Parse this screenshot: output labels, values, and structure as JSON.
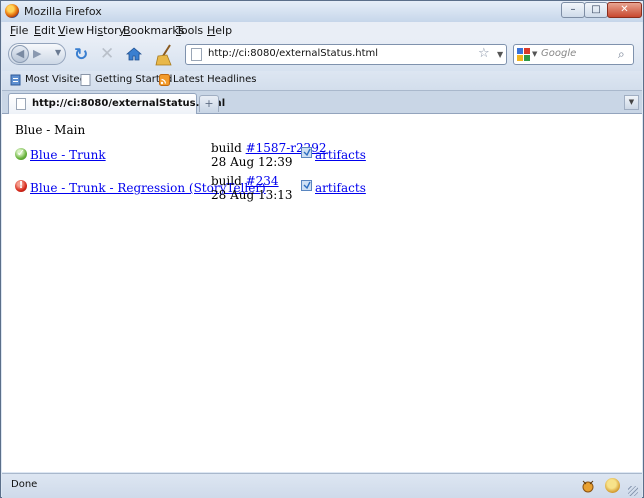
{
  "window": {
    "title": "Mozilla Firefox",
    "minimize": "–",
    "maximize": "□",
    "close": "✕"
  },
  "menubar": [
    {
      "accel": "F",
      "rest": "ile"
    },
    {
      "accel": "E",
      "rest": "dit"
    },
    {
      "accel": "V",
      "rest": "iew"
    },
    {
      "accel": "",
      "pre": "Hi",
      "u": "s",
      "post": "tory"
    },
    {
      "accel": "B",
      "rest": "ookmarks"
    },
    {
      "accel": "T",
      "rest": "ools"
    },
    {
      "accel": "H",
      "rest": "elp"
    }
  ],
  "navbar": {
    "url": "http://ci:8080/externalStatus.html",
    "search_placeholder": "Google"
  },
  "bookmarks": [
    "Most Visited",
    "Getting Started",
    "Latest Headlines"
  ],
  "tabs": [
    {
      "label": "http://ci:8080/externalStatus.html"
    }
  ],
  "content": {
    "group_title": "Blue - Main",
    "projects": [
      {
        "status": "success",
        "name": "Blue - Trunk",
        "build_prefix": "build",
        "build_link": "#1587-r2292",
        "date": "28 Aug 12:39",
        "artifacts": "artifacts"
      },
      {
        "status": "failure",
        "name": "Blue - Trunk - Regression (StoryTeller)",
        "build_prefix": "build",
        "build_link": "#234",
        "date": "28 Aug 13:13",
        "artifacts": "artifacts"
      }
    ]
  },
  "statusbar": {
    "text": "Done"
  },
  "colors": {
    "link": "#0000ee",
    "success": "#67b23a",
    "failure": "#d6281a"
  },
  "icons": {
    "status_success": "checkmark-icon",
    "status_failure": "exclamation-icon",
    "artifacts": "artifacts-icon"
  }
}
